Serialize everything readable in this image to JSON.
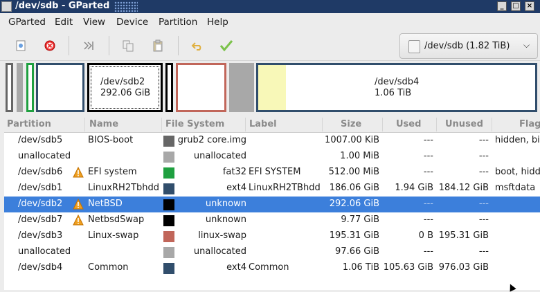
{
  "window": {
    "title": "/dev/sdb - GParted"
  },
  "menu": [
    "GParted",
    "Edit",
    "View",
    "Device",
    "Partition",
    "Help"
  ],
  "toolbar": {
    "buttons": [
      "new-partition",
      "delete-partition",
      "resize-move",
      "copy",
      "paste",
      "undo",
      "apply"
    ]
  },
  "device_selector": {
    "label": "/dev/sdb (1.82 TiB)"
  },
  "diskmap": {
    "sdb2_name": "/dev/sdb2",
    "sdb2_size": "292.06 GiB",
    "sdb4_name": "/dev/sdb4",
    "sdb4_size": "1.06 TiB",
    "sdb4_used_fraction": 0.1
  },
  "columns": [
    "Partition",
    "Name",
    "File System",
    "Label",
    "Size",
    "Used",
    "Unused",
    "Flags"
  ],
  "rows": [
    {
      "partition": "/dev/sdb5",
      "name": "BIOS-boot",
      "fs": "grub2 core.img",
      "label": "",
      "size": "1007.00 KiB",
      "used": "---",
      "unused": "---",
      "flags": "hidden, bios_grub",
      "color": "#666666",
      "warn": false
    },
    {
      "partition": "unallocated",
      "name": "",
      "fs": "unallocated",
      "label": "",
      "size": "1.00 MiB",
      "used": "---",
      "unused": "---",
      "flags": "",
      "color": "#a8a8a8",
      "warn": false
    },
    {
      "partition": "/dev/sdb6",
      "name": "EFI system",
      "fs": "fat32",
      "label": "EFI SYSTEM",
      "size": "512.00 MiB",
      "used": "---",
      "unused": "---",
      "flags": "boot, hidden, esp",
      "color": "#1fa040",
      "warn": true
    },
    {
      "partition": "/dev/sdb1",
      "name": "LinuxRH2Tbhdd",
      "fs": "ext4",
      "label": "LinuxRH2TBhdd",
      "size": "186.06 GiB",
      "used": "1.94 GiB",
      "unused": "184.12 GiB",
      "flags": "msftdata",
      "color": "#314e6c",
      "warn": false
    },
    {
      "partition": "/dev/sdb2",
      "name": "NetBSD",
      "fs": "unknown",
      "label": "",
      "size": "292.06 GiB",
      "used": "---",
      "unused": "---",
      "flags": "",
      "color": "#000000",
      "warn": true,
      "selected": true
    },
    {
      "partition": "/dev/sdb7",
      "name": "NetbsdSwap",
      "fs": "unknown",
      "label": "",
      "size": "9.77 GiB",
      "used": "---",
      "unused": "---",
      "flags": "",
      "color": "#000000",
      "warn": true
    },
    {
      "partition": "/dev/sdb3",
      "name": "Linux-swap",
      "fs": "linux-swap",
      "label": "",
      "size": "195.31 GiB",
      "used": "0 B",
      "unused": "195.31 GiB",
      "flags": "",
      "color": "#c1665a",
      "warn": false
    },
    {
      "partition": "unallocated",
      "name": "",
      "fs": "unallocated",
      "label": "",
      "size": "97.66 GiB",
      "used": "---",
      "unused": "---",
      "flags": "",
      "color": "#a8a8a8",
      "warn": false
    },
    {
      "partition": "/dev/sdb4",
      "name": "Common",
      "fs": "ext4",
      "label": "Common",
      "size": "1.06 TiB",
      "used": "105.63 GiB",
      "unused": "976.03 GiB",
      "flags": "",
      "color": "#314e6c",
      "warn": false
    }
  ],
  "colors": {
    "ext4": "#314e6c",
    "fat32": "#1fa040",
    "linux_swap": "#c1665a",
    "unallocated": "#a8a8a8",
    "unknown": "#000000",
    "selection": "#3c7fdb",
    "used_fill": "#f8f8b8"
  }
}
